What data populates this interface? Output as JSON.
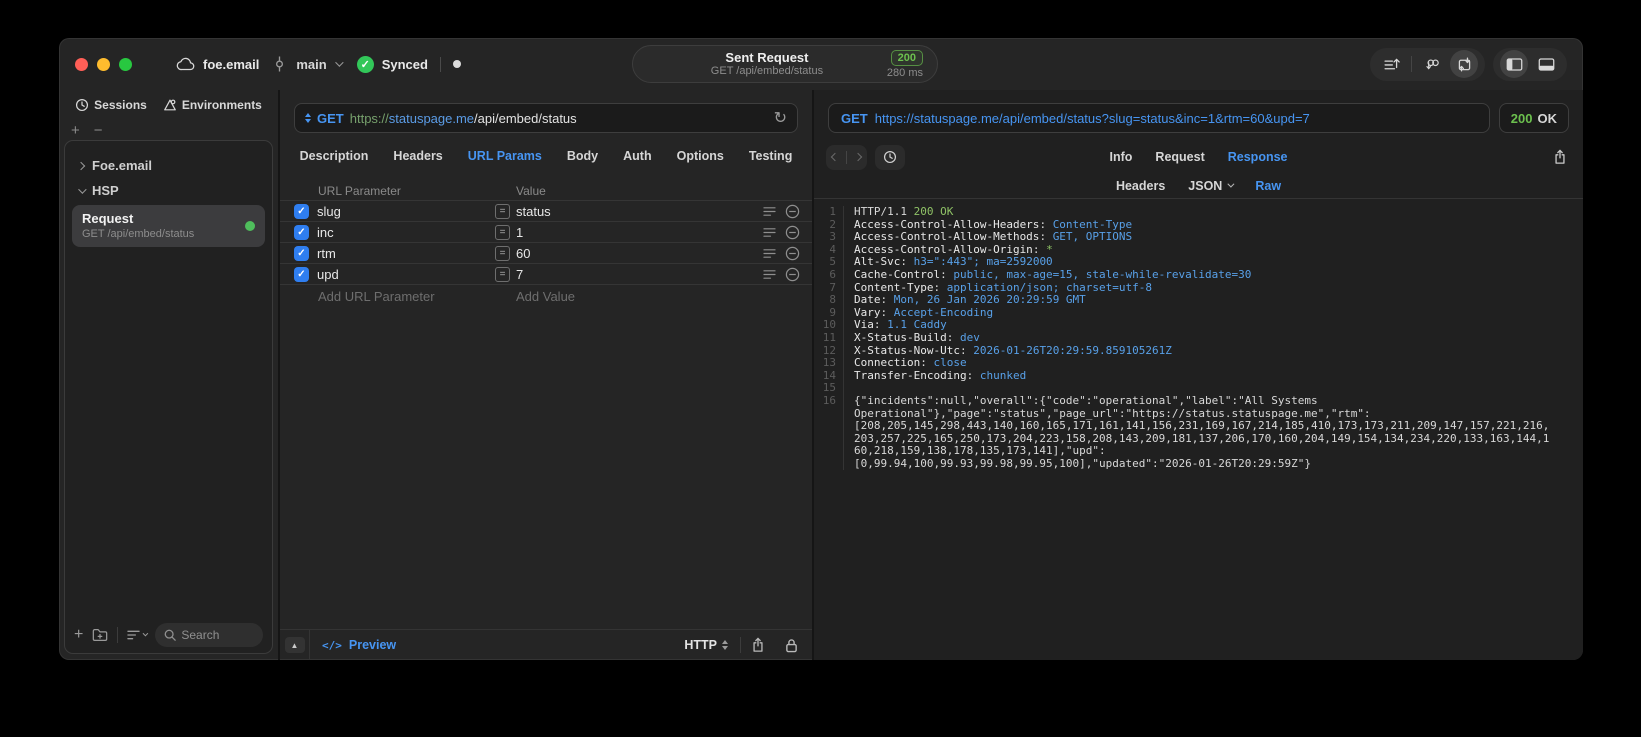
{
  "titlebar": {
    "project": "foe.email",
    "branch": "main",
    "sync_label": "Synced",
    "request_summary": {
      "title": "Sent Request",
      "subtitle": "GET /api/embed/status",
      "status_code": "200",
      "duration": "280 ms"
    }
  },
  "sidebar": {
    "tabs": {
      "sessions": "Sessions",
      "environments": "Environments"
    },
    "tree": [
      {
        "label": "Foe.email"
      },
      {
        "label": "HSP"
      }
    ],
    "request_item": {
      "title": "Request",
      "subtitle": "GET /api/embed/status"
    },
    "search_placeholder": "Search"
  },
  "request_pane": {
    "method": "GET",
    "url": {
      "scheme": "https://",
      "host": "statuspage.me",
      "path": "/api/embed/status"
    },
    "tabs": [
      "Description",
      "Headers",
      "URL Params",
      "Body",
      "Auth",
      "Options",
      "Testing"
    ],
    "active_tab": "URL Params",
    "params": {
      "columns": [
        "URL Parameter",
        "Value"
      ],
      "rows": [
        {
          "name": "slug",
          "value": "status",
          "enabled": true
        },
        {
          "name": "inc",
          "value": "1",
          "enabled": true
        },
        {
          "name": "rtm",
          "value": "60",
          "enabled": true
        },
        {
          "name": "upd",
          "value": "7",
          "enabled": true
        }
      ],
      "add_name_placeholder": "Add URL Parameter",
      "add_value_placeholder": "Add Value"
    },
    "footer": {
      "preview_label": "Preview",
      "code_glyph": "</>",
      "protocol": "HTTP"
    }
  },
  "response_pane": {
    "method": "GET",
    "url": "https://statuspage.me/api/embed/status?slug=status&inc=1&rtm=60&upd=7",
    "status_code": "200",
    "status_text": "OK",
    "tabs": [
      "Info",
      "Request",
      "Response"
    ],
    "active_tab": "Response",
    "subtabs": [
      "Headers",
      "JSON",
      "Raw"
    ],
    "active_subtab": "Raw",
    "code_lines": [
      {
        "num": "1",
        "segs": [
          [
            "p",
            "HTTP/1.1 "
          ],
          [
            "g",
            "200 OK"
          ]
        ]
      },
      {
        "num": "2",
        "segs": [
          [
            "n",
            "Access-Control-Allow-Headers"
          ],
          [
            "p",
            ": "
          ],
          [
            "v",
            "Content-Type"
          ]
        ]
      },
      {
        "num": "3",
        "segs": [
          [
            "n",
            "Access-Control-Allow-Methods"
          ],
          [
            "p",
            ": "
          ],
          [
            "v",
            "GET, OPTIONS"
          ]
        ]
      },
      {
        "num": "4",
        "segs": [
          [
            "n",
            "Access-Control-Allow-Origin"
          ],
          [
            "p",
            ": "
          ],
          [
            "g",
            "*"
          ]
        ]
      },
      {
        "num": "5",
        "segs": [
          [
            "n",
            "Alt-Svc"
          ],
          [
            "p",
            ": "
          ],
          [
            "v",
            "h3=\":443\"; ma=2592000"
          ]
        ]
      },
      {
        "num": "6",
        "segs": [
          [
            "n",
            "Cache-Control"
          ],
          [
            "p",
            ": "
          ],
          [
            "v",
            "public, max-age=15, stale-while-revalidate=30"
          ]
        ]
      },
      {
        "num": "7",
        "segs": [
          [
            "n",
            "Content-Type"
          ],
          [
            "p",
            ": "
          ],
          [
            "v",
            "application/json; charset=utf-8"
          ]
        ]
      },
      {
        "num": "8",
        "segs": [
          [
            "n",
            "Date"
          ],
          [
            "p",
            ": "
          ],
          [
            "v",
            "Mon, 26 Jan 2026 20:29:59 GMT"
          ]
        ]
      },
      {
        "num": "9",
        "segs": [
          [
            "n",
            "Vary"
          ],
          [
            "p",
            ": "
          ],
          [
            "v",
            "Accept-Encoding"
          ]
        ]
      },
      {
        "num": "10",
        "segs": [
          [
            "n",
            "Via"
          ],
          [
            "p",
            ": "
          ],
          [
            "v",
            "1.1 Caddy"
          ]
        ]
      },
      {
        "num": "11",
        "segs": [
          [
            "n",
            "X-Status-Build"
          ],
          [
            "p",
            ": "
          ],
          [
            "v",
            "dev"
          ]
        ]
      },
      {
        "num": "12",
        "segs": [
          [
            "n",
            "X-Status-Now-Utc"
          ],
          [
            "p",
            ": "
          ],
          [
            "v",
            "2026-01-26T20:29:59.859105261Z"
          ]
        ]
      },
      {
        "num": "13",
        "segs": [
          [
            "n",
            "Connection"
          ],
          [
            "p",
            ": "
          ],
          [
            "v",
            "close"
          ]
        ]
      },
      {
        "num": "14",
        "segs": [
          [
            "n",
            "Transfer-Encoding"
          ],
          [
            "p",
            ": "
          ],
          [
            "v",
            "chunked"
          ]
        ]
      },
      {
        "num": "15",
        "segs": []
      },
      {
        "num": "16",
        "segs": [
          [
            "p",
            "{\"incidents\":null,\"overall\":{\"code\":\"operational\",\"label\":\"All Systems"
          ]
        ]
      },
      {
        "num": "",
        "segs": [
          [
            "p",
            "Operational\"},\"page\":\"status\",\"page_url\":\"https://status.statuspage.me\",\"rtm\":"
          ]
        ]
      },
      {
        "num": "",
        "segs": [
          [
            "p",
            "[208,205,145,298,443,140,160,165,171,161,141,156,231,169,167,214,185,410,173,173,211,209,147,157,221,216,"
          ]
        ]
      },
      {
        "num": "",
        "segs": [
          [
            "p",
            "203,257,225,165,250,173,204,223,158,208,143,209,181,137,206,170,160,204,149,154,134,234,220,133,163,144,1"
          ]
        ]
      },
      {
        "num": "",
        "segs": [
          [
            "p",
            "60,218,159,138,178,135,173,141],\"upd\":"
          ]
        ]
      },
      {
        "num": "",
        "segs": [
          [
            "p",
            "[0,99.94,100,99.93,99.98,99.95,100],\"updated\":\"2026-01-26T20:29:59Z\"}"
          ]
        ]
      }
    ]
  },
  "colors": {
    "accent_blue": "#4795f2",
    "sync_green": "#32c759",
    "checkbox_blue": "#2f7ef0",
    "status_green": "#6cc04e",
    "code_value_blue": "#58a0e8",
    "code_green": "#8fc266",
    "url_scheme_green": "#76a06c",
    "url_host_blue": "#5b9ce6",
    "traffic_red": "#ff5f57",
    "traffic_yellow": "#febc2e",
    "traffic_green": "#28c840"
  }
}
